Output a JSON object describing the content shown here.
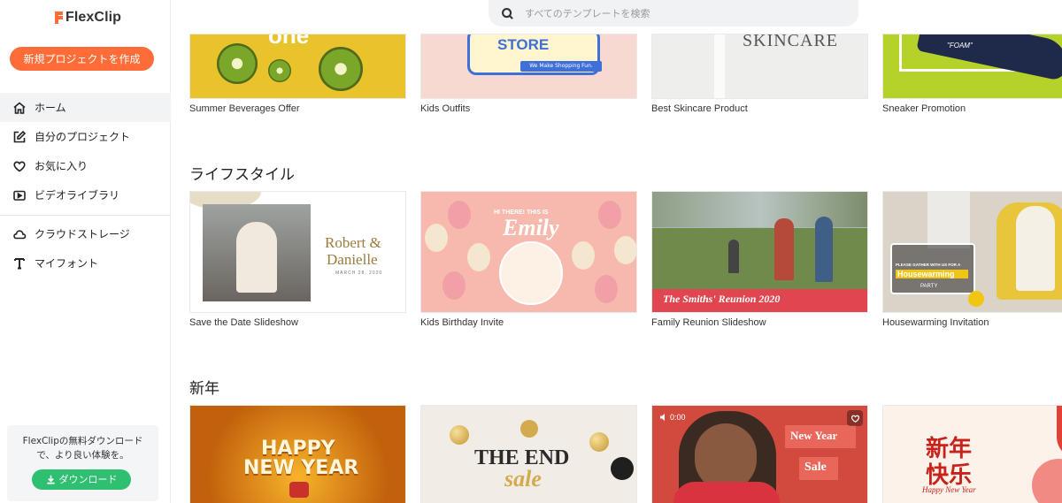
{
  "app": {
    "logo": "FlexClip"
  },
  "sidebar": {
    "new_project_label": "新規プロジェクトを作成",
    "items": [
      {
        "label": "ホーム",
        "icon": "home-icon"
      },
      {
        "label": "自分のプロジェクト",
        "icon": "edit-icon"
      },
      {
        "label": "お気に入り",
        "icon": "heart-icon"
      },
      {
        "label": "ビデオライブラリ",
        "icon": "video-icon"
      },
      {
        "label": "クラウドストレージ",
        "icon": "cloud-icon"
      },
      {
        "label": "マイフォント",
        "icon": "font-icon"
      }
    ],
    "promo": {
      "line1": "FlexClipの無料ダウンロード",
      "line2": "で、より良い体験を。",
      "button": "ダウンロード"
    }
  },
  "search": {
    "placeholder": "すべてのテンプレートを検索"
  },
  "rows": [
    {
      "title": "",
      "cards": [
        {
          "caption": "Summer Beverages Offer",
          "art": "one"
        },
        {
          "caption": "Kids Outfits",
          "art": "STORE",
          "art2": "We Make Shopping Fun."
        },
        {
          "caption": "Best Skincare Product",
          "art": "SKINCARE"
        },
        {
          "caption": "Sneaker Promotion",
          "art": "\"FOAM\""
        }
      ]
    },
    {
      "title": "ライフスタイル",
      "cards": [
        {
          "caption": "Save the Date Slideshow",
          "art": "Robert &",
          "art2": "Danielle",
          "art3": "MARCH 28, 2020"
        },
        {
          "caption": "Kids Birthday Invite",
          "art": "HI THERE!  THIS IS",
          "art2": "Emily"
        },
        {
          "caption": "Family Reunion Slideshow",
          "art": "The Smiths' Reunion 2020"
        },
        {
          "caption": "Housewarming Invitation",
          "art": "PLEASE GATHER WITH US FOR A",
          "art2": "Housewarming",
          "art3": "PARTY"
        }
      ]
    },
    {
      "title": "新年",
      "cards": [
        {
          "caption": "",
          "art": "HAPPY",
          "art2": "NEW YEAR"
        },
        {
          "caption": "",
          "art": "THE END",
          "art2": "sale"
        },
        {
          "caption": "",
          "art": "New Year",
          "art2": "Sale",
          "art3": "0:00"
        },
        {
          "caption": "",
          "art": "新年",
          "art2": "快乐",
          "art3": "Happy New Year"
        }
      ]
    }
  ],
  "colors": {
    "accent": "#ff6c37",
    "download": "#2fbf71",
    "active_bg": "#f2f3f5"
  }
}
